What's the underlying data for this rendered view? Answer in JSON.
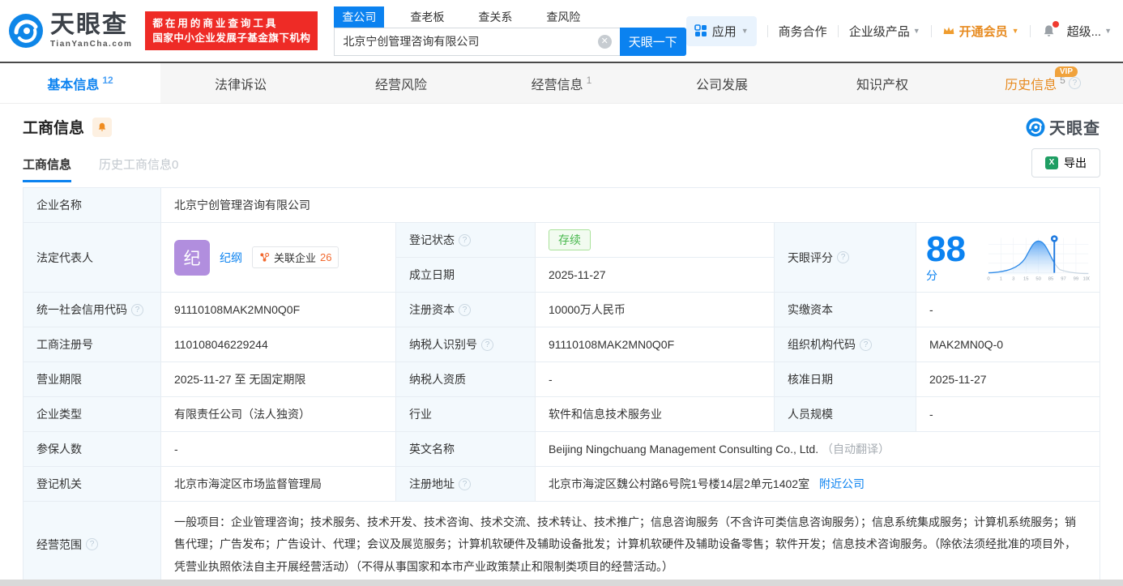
{
  "brand": {
    "logo_text": "天眼查",
    "logo_sub": "TianYanCha.com",
    "slogan_line1": "都在用的商业查询工具",
    "slogan_line2": "国家中小企业发展子基金旗下机构",
    "colors": {
      "primary": "#0b82f0",
      "red": "#ee2b26",
      "orange": "#e78a1f",
      "green": "#49b84e"
    }
  },
  "search": {
    "tabs": [
      {
        "label": "查公司"
      },
      {
        "label": "查老板"
      },
      {
        "label": "查关系"
      },
      {
        "label": "查风险"
      }
    ],
    "value": "北京宁创管理咨询有限公司",
    "button": "天眼一下"
  },
  "top_nav": {
    "apps": "应用",
    "cooperation": "商务合作",
    "enterprise": "企业级产品",
    "vip": "开通会员",
    "more": "超级..."
  },
  "tabs": [
    {
      "label": "基本信息",
      "count": "12"
    },
    {
      "label": "法律诉讼",
      "count": ""
    },
    {
      "label": "经营风险",
      "count": ""
    },
    {
      "label": "经营信息",
      "count": "1"
    },
    {
      "label": "公司发展",
      "count": ""
    },
    {
      "label": "知识产权",
      "count": ""
    },
    {
      "label": "历史信息",
      "count": "5"
    }
  ],
  "vip_badge": "VIP",
  "section": {
    "title": "工商信息",
    "subtab_current": "工商信息",
    "subtab_history": "历史工商信息0",
    "export_label": "导出",
    "watermark": "天眼查"
  },
  "fields": {
    "name": {
      "label": "企业名称",
      "value": "北京宁创管理咨询有限公司"
    },
    "legal_rep": {
      "label": "法定代表人",
      "avatar": "纪",
      "person": "纪纲",
      "related_label": "关联企业",
      "related_count": "26"
    },
    "reg_status": {
      "label": "登记状态",
      "value": "存续"
    },
    "establish_date": {
      "label": "成立日期",
      "value": "2025-11-27"
    },
    "score": {
      "label": "天眼评分",
      "value": "88",
      "unit": "分",
      "axis": [
        "0",
        "1",
        "3",
        "15",
        "50",
        "85",
        "97",
        "99",
        "100"
      ]
    },
    "credit_code": {
      "label": "统一社会信用代码",
      "value": "91110108MAK2MN0Q0F"
    },
    "reg_capital": {
      "label": "注册资本",
      "value": "10000万人民币"
    },
    "paid_capital": {
      "label": "实缴资本",
      "value": "-"
    },
    "reg_number": {
      "label": "工商注册号",
      "value": "110108046229244"
    },
    "taxpayer_id": {
      "label": "纳税人识别号",
      "value": "91110108MAK2MN0Q0F"
    },
    "org_code": {
      "label": "组织机构代码",
      "value": "MAK2MN0Q-0"
    },
    "business_term": {
      "label": "营业期限",
      "value": "2025-11-27 至 无固定期限"
    },
    "taxpayer_quality": {
      "label": "纳税人资质",
      "value": "-"
    },
    "approval_date": {
      "label": "核准日期",
      "value": "2025-11-27"
    },
    "company_type": {
      "label": "企业类型",
      "value": "有限责任公司（法人独资）"
    },
    "industry": {
      "label": "行业",
      "value": "软件和信息技术服务业"
    },
    "staff_size": {
      "label": "人员规模",
      "value": "-"
    },
    "insured_count": {
      "label": "参保人数",
      "value": "-"
    },
    "english_name": {
      "label": "英文名称",
      "value": "Beijing Ningchuang Management Consulting Co., Ltd.",
      "note": "（自动翻译）"
    },
    "reg_authority": {
      "label": "登记机关",
      "value": "北京市海淀区市场监督管理局"
    },
    "reg_address": {
      "label": "注册地址",
      "value": "北京市海淀区魏公村路6号院1号楼14层2单元1402室",
      "nearby_link": "附近公司"
    },
    "business_scope": {
      "label": "经营范围",
      "value": "一般项目：企业管理咨询；技术服务、技术开发、技术咨询、技术交流、技术转让、技术推广；信息咨询服务（不含许可类信息咨询服务）；信息系统集成服务；计算机系统服务；销售代理；广告发布；广告设计、代理；会议及展览服务；计算机软硬件及辅助设备批发；计算机软硬件及辅助设备零售；软件开发；信息技术咨询服务。（除依法须经批准的项目外，凭营业执照依法自主开展经营活动）（不得从事国家和本市产业政策禁止和限制类项目的经营活动。）"
    }
  }
}
